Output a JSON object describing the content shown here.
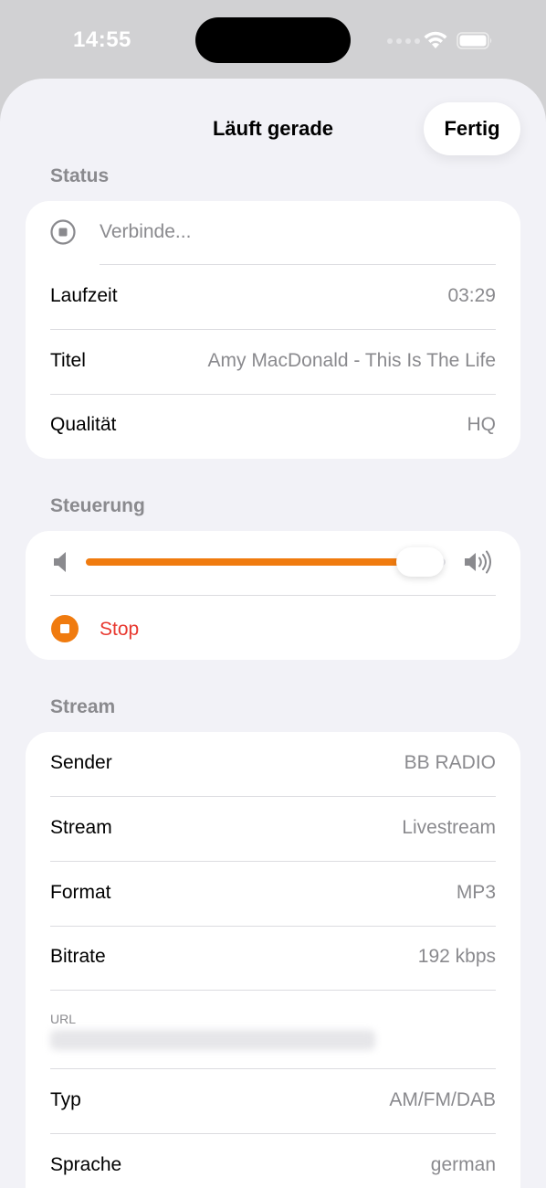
{
  "status_bar": {
    "time": "14:55"
  },
  "nav": {
    "title": "Läuft gerade",
    "done_label": "Fertig"
  },
  "status": {
    "header": "Status",
    "connection_text": "Verbinde...",
    "rows": [
      {
        "label": "Laufzeit",
        "value": "03:29"
      },
      {
        "label": "Titel",
        "value": "Amy MacDonald - This Is The Life"
      },
      {
        "label": "Qualität",
        "value": "HQ"
      }
    ]
  },
  "controls": {
    "header": "Steuerung",
    "volume_level": 0.93,
    "stop_label": "Stop"
  },
  "stream": {
    "header": "Stream",
    "rows": [
      {
        "label": "Sender",
        "value": "BB RADIO"
      },
      {
        "label": "Stream",
        "value": "Livestream"
      },
      {
        "label": "Format",
        "value": "MP3"
      },
      {
        "label": "Bitrate",
        "value": "192 kbps"
      }
    ],
    "url_caption": "URL",
    "url_value": "",
    "rows_after_url": [
      {
        "label": "Typ",
        "value": "AM/FM/DAB"
      },
      {
        "label": "Sprache",
        "value": "german"
      }
    ]
  },
  "colors": {
    "accent": "#f07b0f",
    "stop_text": "#e8382f",
    "secondary_text": "#8a8a8e",
    "background": "#f2f2f7"
  },
  "icons": {
    "connection": "stop-circle-icon",
    "volume_low": "speaker-icon",
    "volume_high": "speaker-wave-icon",
    "stop": "stop-circle-fill-icon",
    "wifi": "wifi-icon",
    "battery": "battery-icon"
  }
}
